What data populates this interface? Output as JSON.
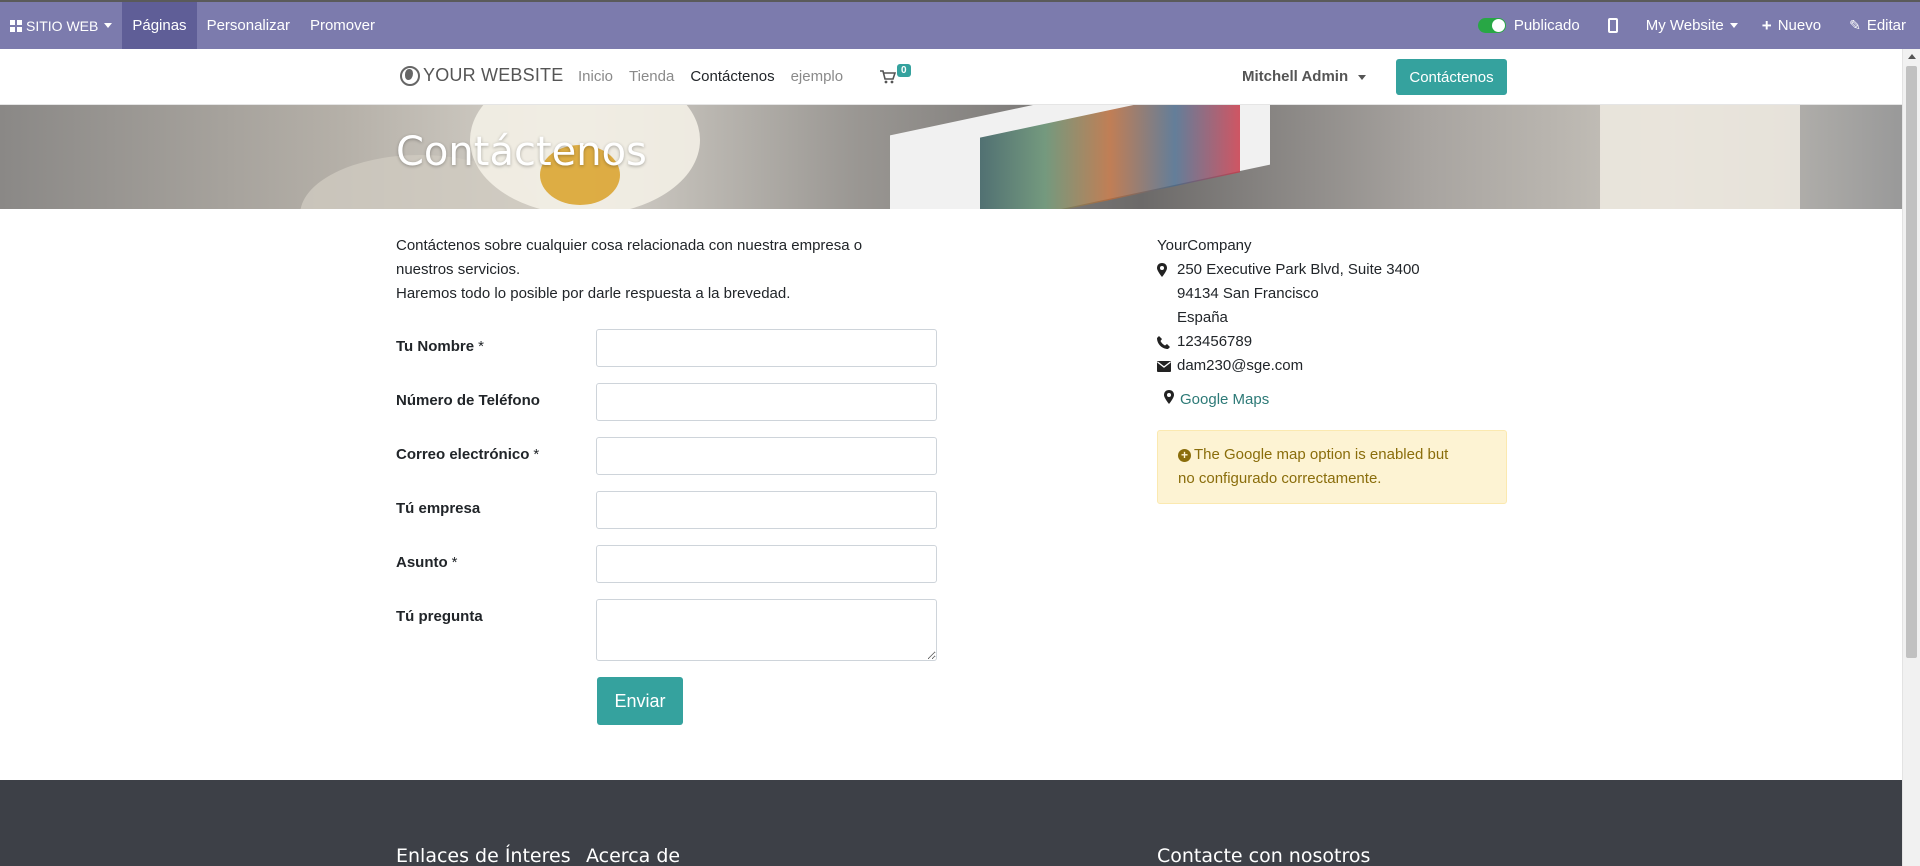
{
  "adminbar": {
    "apps_label": "SITIO WEB",
    "items": [
      "Páginas",
      "Personalizar",
      "Promover"
    ],
    "published_label": "Publicado",
    "website_label": "My Website",
    "new_label": "Nuevo",
    "edit_label": "Editar"
  },
  "header": {
    "logo_text": "YOUR WEBSITE",
    "nav": [
      "Inicio",
      "Tienda",
      "Contáctenos",
      "ejemplo"
    ],
    "cart_count": "0",
    "user_name": "Mitchell Admin",
    "cta_label": "Contáctenos"
  },
  "banner": {
    "title": "Contáctenos"
  },
  "intro": {
    "line1": "Contáctenos sobre cualquier cosa relacionada con nuestra empresa o nuestros servicios.",
    "line2": "Haremos todo lo posible por darle respuesta a la brevedad."
  },
  "form": {
    "fields": [
      {
        "label": "Tu Nombre",
        "required": "*"
      },
      {
        "label": "Número de Teléfono",
        "required": ""
      },
      {
        "label": "Correo electrónico",
        "required": "*"
      },
      {
        "label": "Tú empresa",
        "required": ""
      },
      {
        "label": "Asunto",
        "required": "*"
      },
      {
        "label": "Tú pregunta",
        "required": ""
      }
    ],
    "submit_label": "Enviar"
  },
  "company": {
    "name": "YourCompany",
    "street": "250 Executive Park Blvd, Suite 3400",
    "city": "94134 San Francisco",
    "country": "España",
    "phone": "123456789",
    "email": "dam230@sge.com",
    "maps_link": "Google Maps",
    "alert_text_1": "The Google map option is enabled but",
    "alert_text_2": "no configurado correctamente."
  },
  "footer": {
    "col1": "Enlaces de Ínteres",
    "col2": "Acerca de",
    "col3": "Contacte con nosotros"
  },
  "colors": {
    "admin_bar": "#7c7bad",
    "accent": "#35a29e",
    "footer": "#3d4047",
    "alert_bg": "#fdf3d3"
  },
  "icons": [
    "apps-grid-icon",
    "toggle-icon",
    "mobile-icon",
    "plus-icon",
    "pencil-icon",
    "globe-icon",
    "cart-icon",
    "map-marker-icon",
    "phone-icon",
    "envelope-icon",
    "plus-circle-icon"
  ]
}
